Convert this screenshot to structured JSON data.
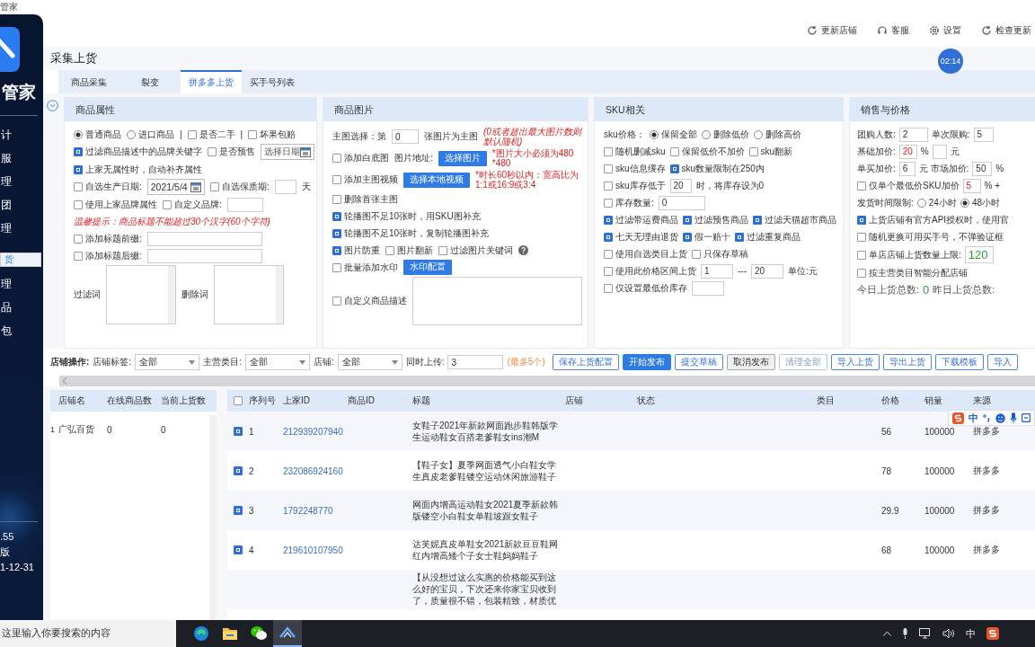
{
  "window": {
    "title": "管家"
  },
  "header_actions": [
    {
      "label": "更新店铺"
    },
    {
      "label": "客服"
    },
    {
      "label": "设置"
    },
    {
      "label": "检查更新"
    }
  ],
  "clock_badge": "02:14",
  "sidebar": {
    "logo": "管家",
    "items": [
      {
        "label": "计",
        "selected": false
      },
      {
        "label": "服",
        "selected": false
      },
      {
        "label": "理",
        "selected": false
      },
      {
        "label": "团",
        "selected": false
      },
      {
        "label": "理",
        "selected": false
      },
      {
        "label": "货",
        "selected": true
      },
      {
        "label": "理",
        "selected": false
      },
      {
        "label": "品",
        "selected": false
      },
      {
        "label": "包",
        "selected": false
      }
    ],
    "footer": [
      ".55",
      "版",
      "1-12-31"
    ]
  },
  "page_title": "采集上货",
  "tabs": [
    {
      "label": "商品采集",
      "selected": false
    },
    {
      "label": "裂变",
      "selected": false
    },
    {
      "label": "拼多多上货",
      "selected": true
    },
    {
      "label": "买手号列表",
      "selected": false
    }
  ],
  "panels": [
    {
      "title": "商品属性",
      "lines": [
        {
          "controls": [
            {
              "kind": "radio",
              "label": "普通商品",
              "selected": true
            },
            {
              "kind": "radio",
              "label": "进口商品",
              "selected": false
            },
            {
              "kind": "text",
              "text": "|"
            },
            {
              "kind": "checkbox",
              "label": "是否二手",
              "checked": false
            },
            {
              "kind": "text",
              "text": "|"
            },
            {
              "kind": "checkbox",
              "label": "坏果包赔",
              "checked": false
            }
          ]
        },
        {
          "controls": [
            {
              "kind": "checkbox",
              "label": "过滤商品描述中的品牌关键字",
              "checked": true
            },
            {
              "kind": "checkbox",
              "label": "是否预售",
              "checked": false
            },
            {
              "kind": "date",
              "placeholder": "选择日期"
            }
          ]
        },
        {
          "controls": [
            {
              "kind": "checkbox",
              "label": "上家无属性时，自动补齐属性",
              "checked": true
            }
          ]
        },
        {
          "controls": [
            {
              "kind": "checkbox",
              "label": "自选生产日期:",
              "checked": false
            },
            {
              "kind": "date",
              "value": "2021/5/4"
            },
            {
              "kind": "checkbox",
              "label": "自选保质期:",
              "checked": false
            },
            {
              "kind": "input"
            },
            {
              "kind": "text",
              "text": "天"
            }
          ]
        },
        {
          "controls": [
            {
              "kind": "checkbox",
              "label": "使用上家品牌属性",
              "checked": false
            },
            {
              "kind": "checkbox",
              "label": "自定义品牌:",
              "checked": false
            },
            {
              "kind": "input"
            }
          ]
        },
        {
          "controls": [
            {
              "kind": "hint",
              "text": "温馨提示：商品标题不能超过30个汉字(60个字符)"
            }
          ]
        },
        {
          "controls": [
            {
              "kind": "checkbox",
              "label": "添加标题前缀:",
              "checked": false
            },
            {
              "kind": "input"
            }
          ]
        },
        {
          "controls": [
            {
              "kind": "checkbox",
              "label": "添加标题后缀:",
              "checked": false
            },
            {
              "kind": "input"
            }
          ]
        },
        {
          "controls": [
            {
              "kind": "text",
              "text": "过滤词"
            },
            {
              "kind": "textarea"
            },
            {
              "kind": "text",
              "text": "删除词"
            },
            {
              "kind": "textarea"
            }
          ]
        }
      ]
    },
    {
      "title": "商品图片",
      "lines": [
        {
          "controls": [
            {
              "kind": "text",
              "text": "主图选择：第"
            },
            {
              "kind": "input",
              "value": "0"
            },
            {
              "kind": "text",
              "text": "张图片为主图"
            },
            {
              "kind": "hint",
              "text": "(0或者超出最大图片数则默认随机)"
            }
          ]
        },
        {
          "controls": [
            {
              "kind": "checkbox",
              "label": "添加白底图",
              "checked": false
            },
            {
              "kind": "text",
              "text": "图片地址:"
            },
            {
              "kind": "button",
              "label": "选择图片"
            },
            {
              "kind": "warn",
              "text": "*图片大小必须为480 *480"
            }
          ]
        },
        {
          "controls": [
            {
              "kind": "checkbox",
              "label": "添加主图视频",
              "checked": false
            },
            {
              "kind": "button",
              "label": "选择本地视频"
            },
            {
              "kind": "warn",
              "text": "*时长60秒以内：宽高比为1:1或16:9或3:4"
            }
          ]
        },
        {
          "controls": [
            {
              "kind": "checkbox",
              "label": "删除首张主图",
              "checked": false
            }
          ]
        },
        {
          "controls": [
            {
              "kind": "checkbox",
              "label": "轮播图不足10张时，用SKU图补充",
              "checked": true
            }
          ]
        },
        {
          "controls": [
            {
              "kind": "checkbox",
              "label": "轮播图不足10张时，复制轮播图补充",
              "checked": true
            }
          ]
        },
        {
          "controls": [
            {
              "kind": "checkbox",
              "label": "图片防重",
              "checked": true
            },
            {
              "kind": "checkbox",
              "label": "图片翻新",
              "checked": false
            },
            {
              "kind": "checkbox",
              "label": "过滤图片关键词",
              "checked": false
            },
            {
              "kind": "help"
            }
          ]
        },
        {
          "controls": [
            {
              "kind": "checkbox",
              "label": "批量添加水印",
              "checked": false
            },
            {
              "kind": "button",
              "label": "水印配置"
            }
          ]
        },
        {
          "controls": [
            {
              "kind": "checkbox",
              "label": "自定义商品描述",
              "checked": false
            },
            {
              "kind": "textarea"
            }
          ]
        }
      ]
    },
    {
      "title": "SKU相关",
      "lines": [
        {
          "controls": [
            {
              "kind": "text",
              "text": "sku价格："
            },
            {
              "kind": "radio",
              "label": "保留全部",
              "selected": true
            },
            {
              "kind": "radio",
              "label": "删除低价",
              "selected": false
            },
            {
              "kind": "radio",
              "label": "删除高价",
              "selected": false
            }
          ]
        },
        {
          "controls": [
            {
              "kind": "checkbox",
              "label": "随机删减sku",
              "checked": false
            },
            {
              "kind": "checkbox",
              "label": "保留低价不加价",
              "checked": false
            },
            {
              "kind": "checkbox",
              "label": "sku翻新",
              "checked": false
            }
          ]
        },
        {
          "controls": [
            {
              "kind": "checkbox",
              "label": "sku信息缓存",
              "checked": false
            },
            {
              "kind": "checkbox",
              "label": "sku数量限制在250内",
              "checked": true
            }
          ]
        },
        {
          "controls": [
            {
              "kind": "checkbox",
              "label": "sku库存低于",
              "checked": false
            },
            {
              "kind": "input",
              "value": "20"
            },
            {
              "kind": "text",
              "text": "时，将库存设为0"
            }
          ]
        },
        {
          "controls": [
            {
              "kind": "checkbox",
              "label": "库存数量:",
              "checked": false
            },
            {
              "kind": "input",
              "value": "0"
            }
          ]
        },
        {
          "controls": [
            {
              "kind": "checkbox",
              "label": "过滤带运费商品",
              "checked": true
            },
            {
              "kind": "checkbox",
              "label": "过滤预售商品",
              "checked": true
            },
            {
              "kind": "checkbox",
              "label": "过滤天猫超市商品",
              "checked": true
            }
          ]
        },
        {
          "controls": [
            {
              "kind": "checkbox",
              "label": "七天无理由退货",
              "checked": true
            },
            {
              "kind": "checkbox",
              "label": "假一赔十",
              "checked": true
            },
            {
              "kind": "checkbox",
              "label": "过滤重复商品",
              "checked": true
            }
          ]
        },
        {
          "controls": [
            {
              "kind": "checkbox",
              "label": "使用自选类目上货",
              "checked": false
            },
            {
              "kind": "checkbox",
              "label": "只保存草稿",
              "checked": false
            }
          ]
        },
        {
          "controls": [
            {
              "kind": "checkbox",
              "label": "使用此价格区间上货",
              "checked": false
            },
            {
              "kind": "input",
              "value": "1"
            },
            {
              "kind": "text",
              "text": "---"
            },
            {
              "kind": "input",
              "value": "20"
            },
            {
              "kind": "text",
              "text": "单位:元"
            }
          ]
        },
        {
          "controls": [
            {
              "kind": "checkbox",
              "label": "仅设置最低价库存",
              "checked": false
            },
            {
              "kind": "input"
            }
          ]
        }
      ]
    },
    {
      "title": "销售与价格",
      "lines": [
        {
          "controls": [
            {
              "kind": "text",
              "text": "团购人数:"
            },
            {
              "kind": "input",
              "value": "2"
            },
            {
              "kind": "text",
              "text": "单次限购:"
            },
            {
              "kind": "input",
              "value": "5"
            }
          ]
        },
        {
          "controls": [
            {
              "kind": "text",
              "text": "基础加价:"
            },
            {
              "kind": "input",
              "value": "20"
            },
            {
              "kind": "text",
              "text": "%"
            },
            {
              "kind": "input"
            },
            {
              "kind": "text",
              "text": "元"
            }
          ]
        },
        {
          "controls": [
            {
              "kind": "text",
              "text": "单买加价:"
            },
            {
              "kind": "input",
              "value": "6"
            },
            {
              "kind": "text",
              "text": "元 市场加价:"
            },
            {
              "kind": "input",
              "value": "50"
            },
            {
              "kind": "text",
              "text": "%"
            }
          ]
        },
        {
          "controls": [
            {
              "kind": "checkbox",
              "label": "仅单个最低价SKU加价",
              "checked": false
            },
            {
              "kind": "input",
              "value": "5"
            },
            {
              "kind": "text",
              "text": "% +"
            }
          ]
        },
        {
          "controls": [
            {
              "kind": "text",
              "text": "发货时间限制:"
            },
            {
              "kind": "radio",
              "label": "24小时",
              "selected": false
            },
            {
              "kind": "radio",
              "label": "48小时",
              "selected": true
            }
          ]
        },
        {
          "controls": [
            {
              "kind": "checkbox",
              "label": "上货店铺有官方API授权时，使用官",
              "checked": true
            }
          ]
        },
        {
          "controls": [
            {
              "kind": "checkbox",
              "label": "随机更换可用买手号，不弹验证框",
              "checked": false
            }
          ]
        },
        {
          "controls": [
            {
              "kind": "checkbox",
              "label": "单店店铺上货数量上限:",
              "checked": false
            },
            {
              "kind": "input",
              "value": "120"
            }
          ]
        },
        {
          "controls": [
            {
              "kind": "checkbox",
              "label": "按主营类目智能分配店铺",
              "checked": false
            }
          ]
        },
        {
          "controls": [
            {
              "kind": "stat",
              "text": "今日上货总数:"
            },
            {
              "kind": "count",
              "text": "0"
            },
            {
              "kind": "stat",
              "text": "昨日上货总数:"
            }
          ]
        }
      ]
    }
  ],
  "toolbar": [
    {
      "kind": "label",
      "text": "店铺操作:"
    },
    {
      "kind": "text",
      "text": "店铺标签:"
    },
    {
      "kind": "select",
      "value": "全部"
    },
    {
      "kind": "text",
      "text": "主营类目:"
    },
    {
      "kind": "select",
      "value": "全部"
    },
    {
      "kind": "text",
      "text": "店铺:"
    },
    {
      "kind": "select",
      "value": "全部"
    },
    {
      "kind": "text",
      "text": "同时上传:"
    },
    {
      "kind": "input",
      "value": "3"
    },
    {
      "kind": "hint",
      "text": "(最多5个)"
    },
    {
      "kind": "button",
      "label": "保存上货配置",
      "disabled": false
    },
    {
      "kind": "primary_button",
      "label": "开始发布",
      "disabled": false
    },
    {
      "kind": "button",
      "label": "提交草稿",
      "disabled": false
    },
    {
      "kind": "neutral_button",
      "label": "取消发布",
      "disabled": false
    },
    {
      "kind": "button",
      "label": "清理全部",
      "disabled": true
    },
    {
      "kind": "button",
      "label": "导入上货",
      "disabled": false
    },
    {
      "kind": "button",
      "label": "导出上货",
      "disabled": false
    },
    {
      "kind": "button",
      "label": "下载模板",
      "disabled": false
    },
    {
      "kind": "button",
      "label": "导入",
      "disabled": false
    }
  ],
  "shop_table": {
    "columns": [
      "店铺名",
      "在线商品数",
      "当前上货数"
    ],
    "rows": [
      {
        "index": "1",
        "name": "广弘百货",
        "online": "0",
        "current": "0"
      }
    ]
  },
  "product_table": {
    "all_selected": false,
    "columns": [
      "序列号",
      "上家ID",
      "商品ID",
      "标题",
      "店铺",
      "状态",
      "类目",
      "价格",
      "销量",
      "来源"
    ],
    "rows": [
      {
        "selected": true,
        "index": "1",
        "source_id": "212939207940",
        "title": "女鞋子2021年新款网面跑步鞋韩版学生运动鞋女百搭老爹鞋女ins潮M",
        "price": "56",
        "sales": "100000",
        "source": "拼多多"
      },
      {
        "selected": true,
        "index": "2",
        "source_id": "232086924160",
        "title": "【鞋子女】夏季网面透气小白鞋女学生真皮老爹鞋镂空运动休闲旅游鞋子",
        "price": "78",
        "sales": "100000",
        "source": "拼多多"
      },
      {
        "selected": true,
        "index": "3",
        "source_id": "1792248770",
        "title": "网面内增高运动鞋女2021夏季新款韩版镂空小白鞋女单鞋坡跟女鞋子",
        "price": "29.9",
        "sales": "100000",
        "source": "拼多多"
      },
      {
        "selected": true,
        "index": "4",
        "source_id": "219610107950",
        "title": "达芙妮真皮单鞋女2021新款豆豆鞋网红内增高矮个子女士鞋妈妈鞋子",
        "price": "68",
        "sales": "100000",
        "source": "拼多多"
      },
      {
        "title": "【从没想过这么实惠的价格能买到这么好的宝贝，下次还来你家宝贝收到了，质量很不错，包装精致，材质优"
      }
    ]
  },
  "ime_bar": {
    "mode": "中"
  },
  "taskbar": {
    "search_placeholder": "这里输入你要搜索的内容",
    "apps": [
      {
        "selected": false
      },
      {
        "selected": false
      },
      {
        "selected": false
      },
      {
        "selected": true
      }
    ],
    "tray_language": "中"
  }
}
